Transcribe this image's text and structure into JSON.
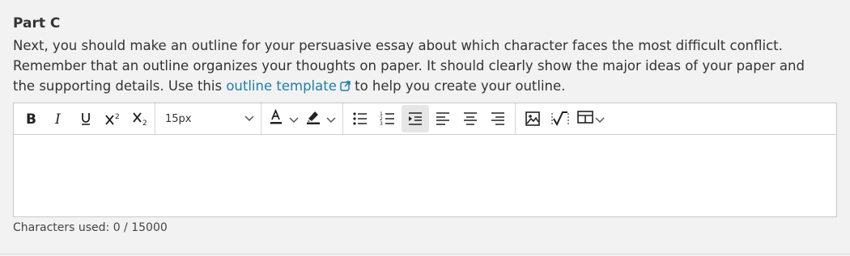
{
  "part": {
    "title": "Part C"
  },
  "prompt": {
    "text_before": "Next, you should make an outline for your persuasive essay about which character faces the most difficult conflict. Remember that an outline organizes your thoughts on paper. It should clearly show the major ideas of your paper and the supporting details. Use this ",
    "link_text": "outline template",
    "link_icon": "external-link-icon",
    "text_after": " to help you create your outline."
  },
  "toolbar": {
    "font_size": "15px",
    "buttons": [
      "bold-icon",
      "italic-icon",
      "underline-icon",
      "superscript-icon",
      "subscript-icon",
      "font-color-icon",
      "highlight-icon",
      "bulleted-list-icon",
      "numbered-list-icon",
      "indent-icon",
      "align-left-icon",
      "align-center-icon",
      "align-right-icon",
      "image-icon",
      "math-icon",
      "table-icon"
    ]
  },
  "counter": {
    "label": "Characters used: 0 / 15000"
  },
  "colors": {
    "link": "#1f7fa6",
    "background": "#f2f2f2",
    "active_button": "#e6e6e6"
  }
}
